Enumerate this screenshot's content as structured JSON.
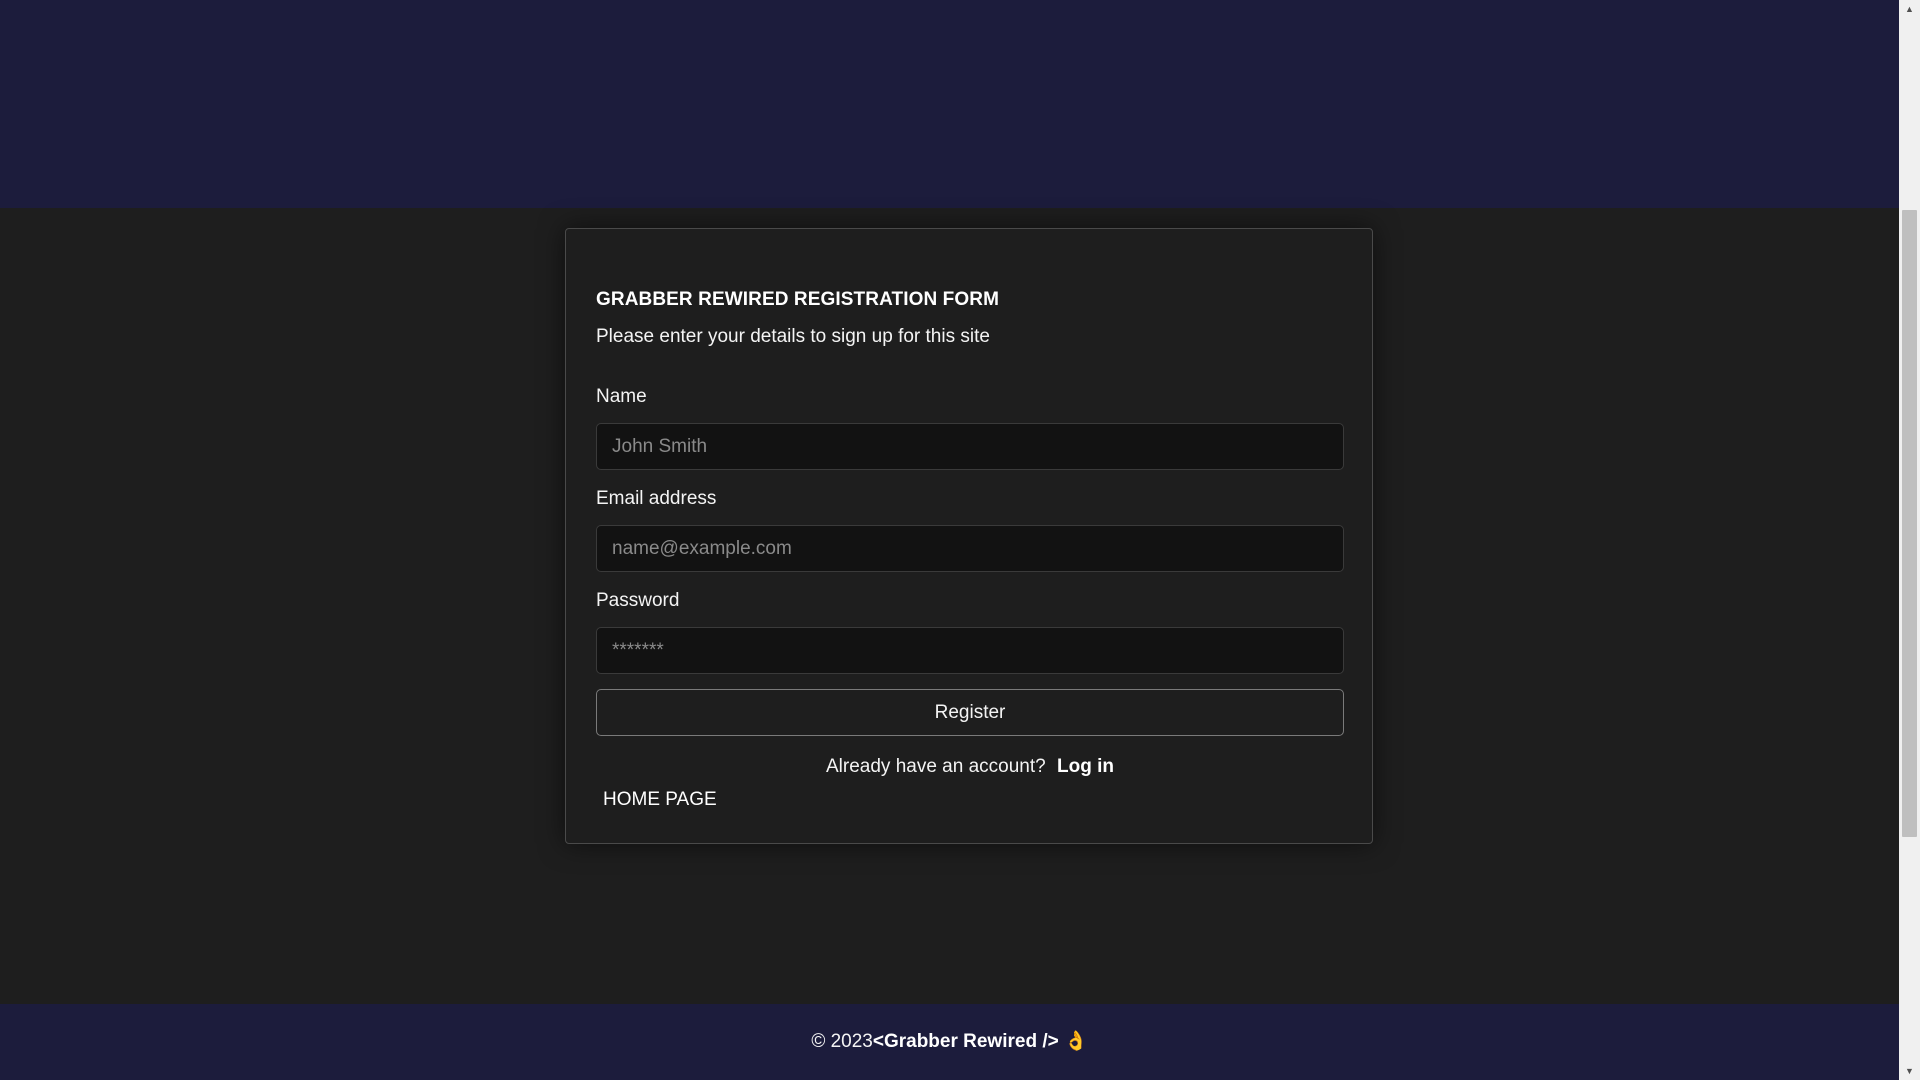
{
  "form": {
    "title": "GRABBER REWIRED REGISTRATION FORM",
    "subtitle": "Please enter your details to sign up for this site",
    "name_label": "Name",
    "name_placeholder": "John Smith",
    "email_label": "Email address",
    "email_placeholder": "name@example.com",
    "password_label": "Password",
    "password_placeholder": "*******",
    "register_label": "Register",
    "login_prompt": "Already have an account?",
    "login_link": "Log in",
    "home_link": "HOME PAGE"
  },
  "footer": {
    "copyright": "© 2023",
    "brand": "<Grabber Rewired />",
    "emoji": "👌"
  },
  "scrollbar": {
    "up_arrow": "▲",
    "down_arrow": "▼"
  },
  "colors": {
    "background": "#1e1e1e",
    "header_band": "#1c1c3c",
    "footer_band": "#1c1c3c",
    "input_background": "#121212"
  }
}
